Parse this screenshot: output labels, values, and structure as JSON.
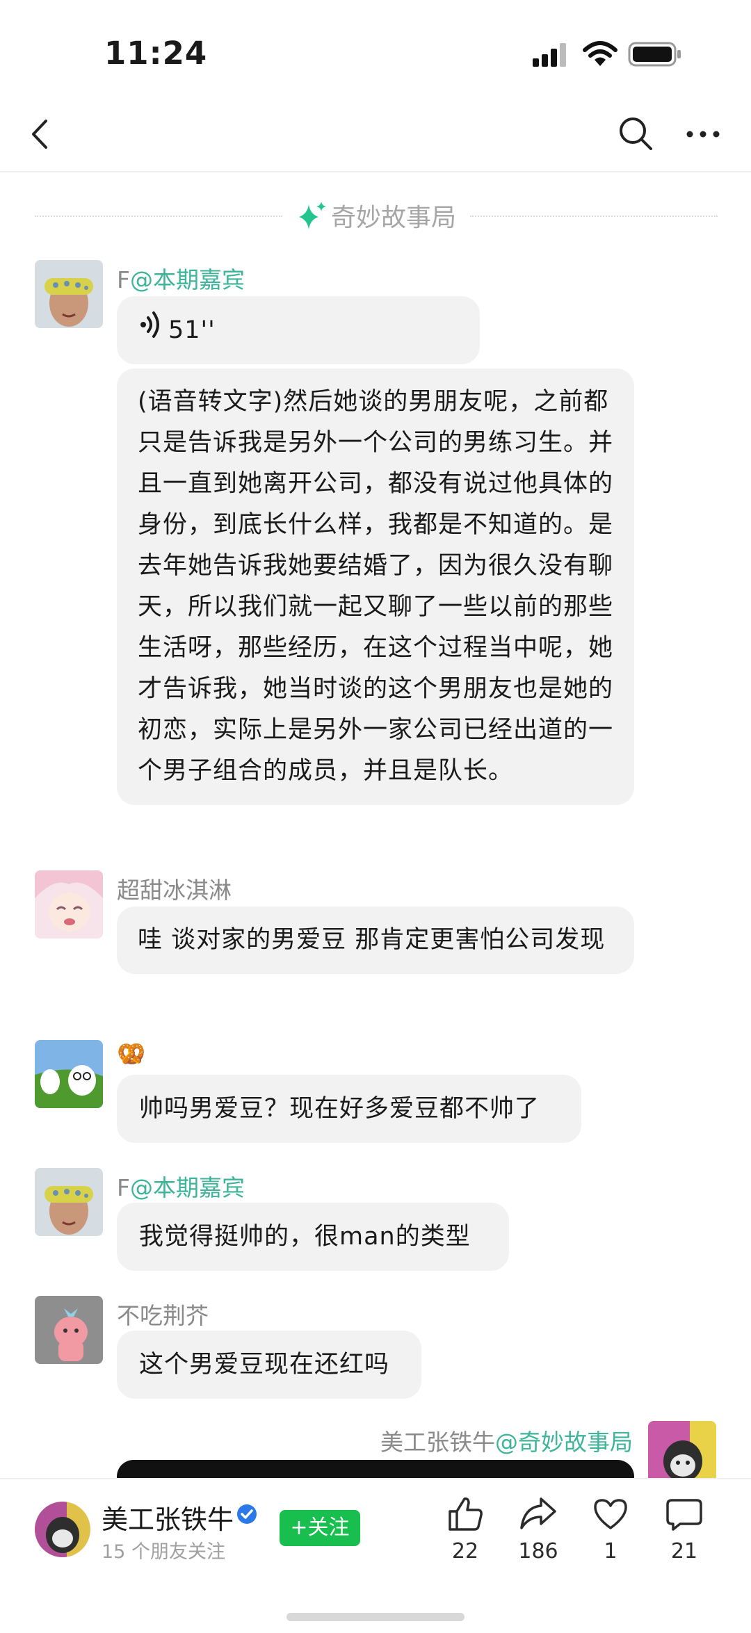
{
  "status_bar": {
    "time": "11:24"
  },
  "group": {
    "title": "奇妙故事局"
  },
  "messages": [
    {
      "user": "F",
      "tag": "@本期嘉宾",
      "voice_duration": "51''",
      "text": "(语音转文字)然后她谈的男朋友呢，之前都只是告诉我是另外一个公司的男练习生。并且一直到她离开公司，都没有说过他具体的身份，到底长什么样，我都是不知道的。是去年她告诉我她要结婚了，因为很久没有聊天，所以我们就一起又聊了一些以前的那些生活呀，那些经历，在这个过程当中呢，她才告诉我，她当时谈的这个男朋友也是她的初恋，实际上是另外一家公司已经出道的一个男子组合的成员，并且是队长。"
    },
    {
      "user": "超甜冰淇淋",
      "text": "哇 谈对家的男爱豆 那肯定更害怕公司发现"
    },
    {
      "user": "🥨",
      "text": "帅吗男爱豆？现在好多爱豆都不帅了"
    },
    {
      "user": "F",
      "tag": "@本期嘉宾",
      "text": "我觉得挺帅的，很man的类型"
    },
    {
      "user": "不吃荆芥",
      "text": "这个男爱豆现在还红吗"
    },
    {
      "user": "美工张铁牛",
      "tag": "@奇妙故事局"
    }
  ],
  "author": {
    "name": "美工张铁牛",
    "friends_follow": "15 个朋友关注",
    "follow_label": "+关注"
  },
  "actions": {
    "likes": "22",
    "shares": "186",
    "favorites": "1",
    "comments": "21"
  },
  "colors": {
    "accent_green": "#3eb49a",
    "follow_button": "#18bf4f",
    "bubble_bg": "#f2f2f2"
  }
}
